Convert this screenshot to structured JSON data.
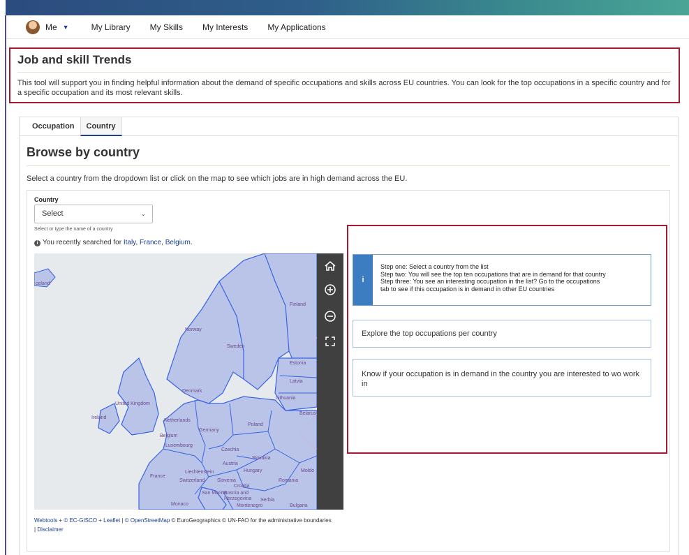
{
  "nav": {
    "me_label": "Me",
    "items": [
      "My Library",
      "My Skills",
      "My Interests",
      "My Applications"
    ]
  },
  "intro": {
    "title": "Job and skill Trends",
    "description": "This tool will support you in finding helpful information about the demand of specific occupations and skills across EU countries. You can look for the top occupations in a specific country and for a specific occupation and its most relevant skills."
  },
  "tabs": [
    {
      "label": "Occupation",
      "active": false
    },
    {
      "label": "Country",
      "active": true
    }
  ],
  "browse": {
    "title": "Browse by country",
    "description": "Select a country from the dropdown list or click on the map to see which jobs are in high demand across the EU.",
    "country_label": "Country",
    "select_value": "Select",
    "select_help": "Select or type the name of a country",
    "recent_prefix": "You recently searched for",
    "recent_countries": [
      "Italy",
      "France",
      "Belgium"
    ]
  },
  "map": {
    "labels": [
      "celand",
      "Finland",
      "Norway",
      "Sweden",
      "Estonia",
      "Latvia",
      "Denmark",
      "Lithuania",
      "United Kingdom",
      "Ireland",
      "Netherlands",
      "Belarus",
      "Poland",
      "Germany",
      "Belgium",
      "Luxembourg",
      "Czechia",
      "Slovakia",
      "Liechtenstein",
      "Austria",
      "Hungary",
      "Moldo",
      "France",
      "Switzerland",
      "Slovenia",
      "Croatia",
      "Romania",
      "San Marino",
      "Bosnia and Herzegovina",
      "Serbia",
      "Monaco",
      "Montenegro",
      "Bulgaria"
    ],
    "controls": [
      "home-icon",
      "zoom-in-icon",
      "zoom-out-icon",
      "fullscreen-icon"
    ],
    "attribution": {
      "webtools": "Webtools",
      "ec_gisco": "© EC-GISCO",
      "leaflet": "Leaflet",
      "osm": "© OpenStreetMap",
      "rest": "© EuroGeographics © UN-FAO for the administrative boundaries |",
      "disclaimer": "Disclaimer"
    }
  },
  "steps": {
    "lines": [
      "Step one: Select a country from the list",
      "Step two: You will see the top ten occupations that are in demand for that country",
      "Step three: You see an interesting occupation in the list? Go to the occupations",
      "tab to see if  this occupation is in demand in other EU countries"
    ],
    "card_explore": "Explore the top occupations per country",
    "card_know": "Know if your occupation is in demand in the country you are interested to wo work in"
  },
  "colors": {
    "accent_red": "#a6192e",
    "link_blue": "#1f3e8c",
    "info_blue": "#3c7cc0",
    "map_country_fill": "#b9c4e8",
    "map_border": "#3a63e0"
  }
}
